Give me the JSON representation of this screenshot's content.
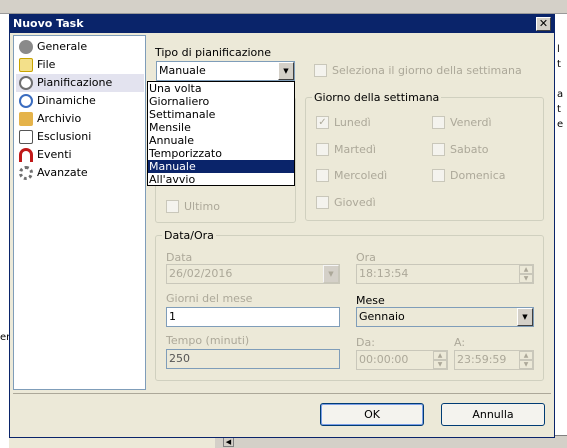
{
  "dialog": {
    "title": "Nuovo Task",
    "close_glyph": "✕"
  },
  "nav": {
    "items": [
      {
        "label": "Generale",
        "icon": "user-icon",
        "color": "#8a8a8a"
      },
      {
        "label": "File",
        "icon": "file-icon",
        "color": "#d6b100"
      },
      {
        "label": "Pianificazione",
        "icon": "clock-icon",
        "color": "#6f6f6f"
      },
      {
        "label": "Dinamiche",
        "icon": "refresh-icon",
        "color": "#3a6cc0"
      },
      {
        "label": "Archivio",
        "icon": "folder-icon",
        "color": "#e5b34a"
      },
      {
        "label": "Esclusioni",
        "icon": "exclude-icon",
        "color": "#555555"
      },
      {
        "label": "Eventi",
        "icon": "magnet-icon",
        "color": "#c01818"
      },
      {
        "label": "Avanzate",
        "icon": "gear-icon",
        "color": "#707070"
      }
    ],
    "selected": "Pianificazione"
  },
  "schedule": {
    "type_label": "Tipo di pianificazione",
    "type_value": "Manuale",
    "options": [
      "Una volta",
      "Giornaliero",
      "Settimanale",
      "Mensile",
      "Annuale",
      "Temporizzato",
      "Manuale",
      "All'avvio"
    ],
    "selected_option": "Manuale",
    "select_weekday_label": "Seleziona il giorno della settimana",
    "last_label": "Ultimo"
  },
  "weekday_group": {
    "title": "Giorno della settimana",
    "days": [
      {
        "label": "Lunedì",
        "checked": true
      },
      {
        "label": "Martedì",
        "checked": false
      },
      {
        "label": "Mercoledì",
        "checked": false
      },
      {
        "label": "Giovedì",
        "checked": false
      },
      {
        "label": "Venerdì",
        "checked": false
      },
      {
        "label": "Sabato",
        "checked": false
      },
      {
        "label": "Domenica",
        "checked": false
      }
    ]
  },
  "datetime": {
    "title": "Data/Ora",
    "date_label": "Data",
    "date_value": "26/02/2016",
    "time_label": "Ora",
    "time_value": "18:13:54",
    "days_of_month_label": "Giorni del mese",
    "days_of_month_value": "1",
    "month_label": "Mese",
    "month_value": "Gennaio",
    "interval_label": "Tempo (minuti)",
    "interval_value": "250",
    "from_label": "Da:",
    "from_value": "00:00:00",
    "to_label": "A:",
    "to_value": "23:59:59"
  },
  "buttons": {
    "ok": "OK",
    "cancel": "Annulla"
  },
  "background": {
    "right_chars": [
      "l",
      "t",
      "a",
      "t",
      "e"
    ],
    "left_fragment": "er"
  }
}
